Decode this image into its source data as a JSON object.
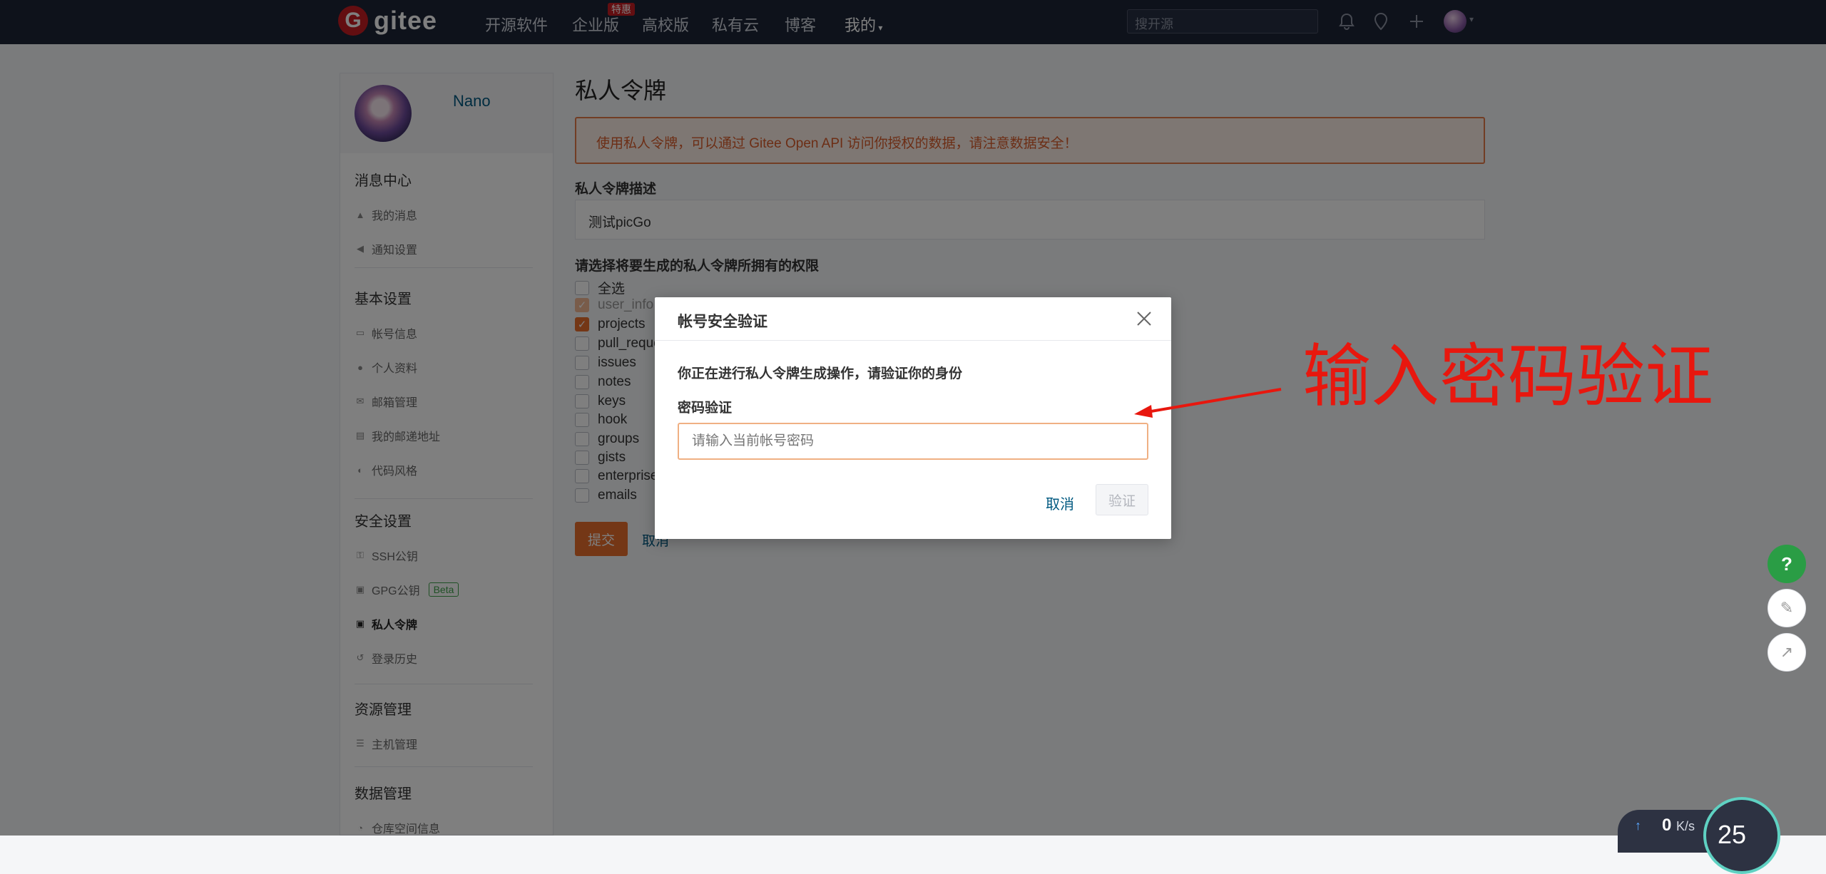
{
  "navbar": {
    "logo_mark": "G",
    "logo_text": "gitee",
    "items": [
      "开源软件",
      "企业版",
      "高校版",
      "私有云",
      "博客",
      "我的"
    ],
    "badge": "特惠",
    "search_placeholder": "搜开源"
  },
  "sidebar": {
    "username": "Nano",
    "sections": {
      "messages": {
        "title": "消息中心",
        "items": [
          "我的消息",
          "通知设置"
        ]
      },
      "basic": {
        "title": "基本设置",
        "items": [
          "帐号信息",
          "个人资料",
          "邮箱管理",
          "我的邮递地址",
          "代码风格"
        ]
      },
      "security": {
        "title": "安全设置",
        "items": [
          "SSH公钥",
          "GPG公钥",
          "私人令牌",
          "登录历史"
        ],
        "beta": "Beta"
      },
      "resources": {
        "title": "资源管理",
        "items": [
          "主机管理"
        ]
      },
      "data": {
        "title": "数据管理",
        "items": [
          "仓库空间信息"
        ]
      }
    }
  },
  "main": {
    "title": "私人令牌",
    "alert": "使用私人令牌，可以通过 Gitee Open API 访问你授权的数据，请注意数据安全！",
    "desc_label": "私人令牌描述",
    "desc_value": "测试picGo",
    "perm_label": "请选择将要生成的私人令牌所拥有的权限",
    "permissions": [
      {
        "label": "全选",
        "checked": false
      },
      {
        "label": "user_info",
        "checked": true,
        "disabled": true
      },
      {
        "label": "projects",
        "checked": true
      },
      {
        "label": "pull_requests",
        "checked": false
      },
      {
        "label": "issues",
        "checked": false
      },
      {
        "label": "notes",
        "checked": false
      },
      {
        "label": "keys",
        "checked": false
      },
      {
        "label": "hook",
        "checked": false
      },
      {
        "label": "groups",
        "checked": false
      },
      {
        "label": "gists",
        "checked": false
      },
      {
        "label": "enterprises",
        "checked": false
      },
      {
        "label": "emails",
        "checked": false
      }
    ],
    "submit_label": "提交",
    "cancel_label": "取消"
  },
  "modal": {
    "title": "帐号安全验证",
    "text": "你正在进行私人令牌生成操作，请验证你的身份",
    "label": "密码验证",
    "placeholder": "请输入当前帐号密码",
    "cancel_label": "取消",
    "verify_label": "验证"
  },
  "annotation": {
    "text": "输入密码验证",
    "color": "#e8170e"
  },
  "widgets": {
    "help": "?",
    "speed_value": "0",
    "speed_unit": "K/s",
    "gauge_value": "25"
  },
  "colors": {
    "accent": "#e96e2c",
    "navbar": "#1c2436",
    "link": "#005980",
    "help": "#2a9d45"
  }
}
